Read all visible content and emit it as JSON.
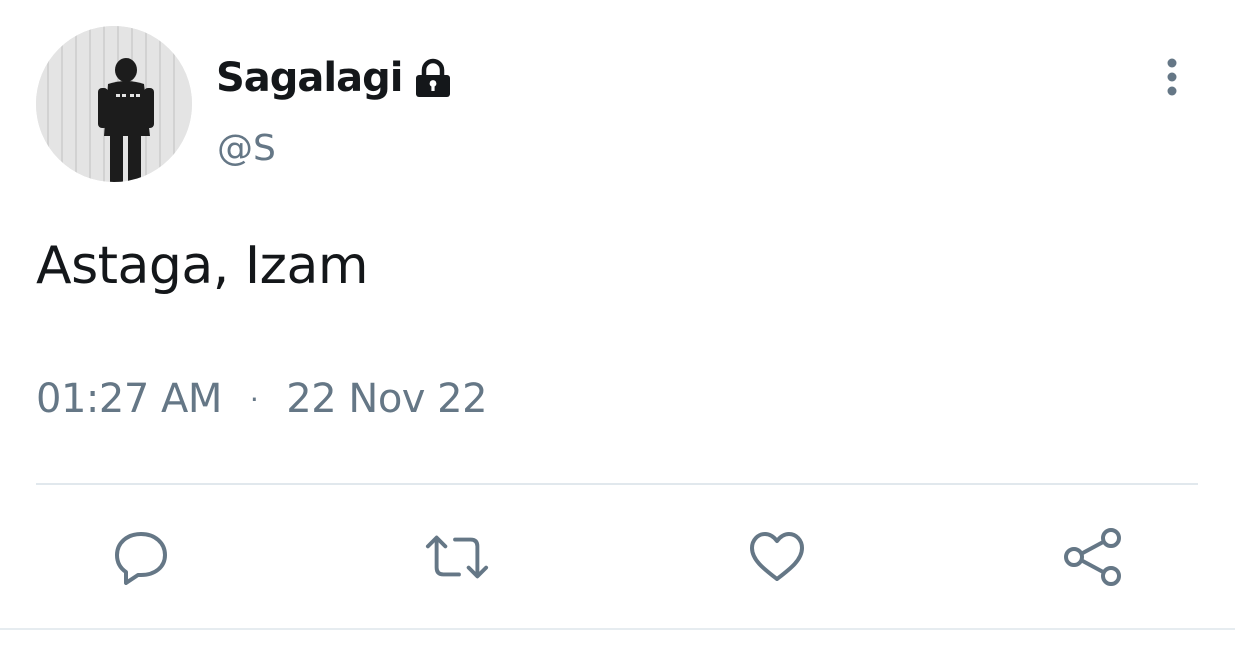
{
  "tweet": {
    "author": {
      "display_name": "Sagalagi",
      "handle": "@S",
      "protected_icon": "lock-icon",
      "avatar": "profile-photo"
    },
    "text": "Astaga, Izam",
    "time": "01:27 AM",
    "separator": "·",
    "date": "22 Nov 22",
    "more_icon": "more-vertical-icon"
  },
  "actions": [
    {
      "name": "reply",
      "icon": "comment-icon"
    },
    {
      "name": "retweet",
      "icon": "retweet-icon"
    },
    {
      "name": "like",
      "icon": "heart-icon"
    },
    {
      "name": "share",
      "icon": "share-icon"
    }
  ],
  "colors": {
    "text_primary": "#14171a",
    "text_secondary": "#657786",
    "icon": "#657786",
    "divider": "#e1e8ed"
  }
}
